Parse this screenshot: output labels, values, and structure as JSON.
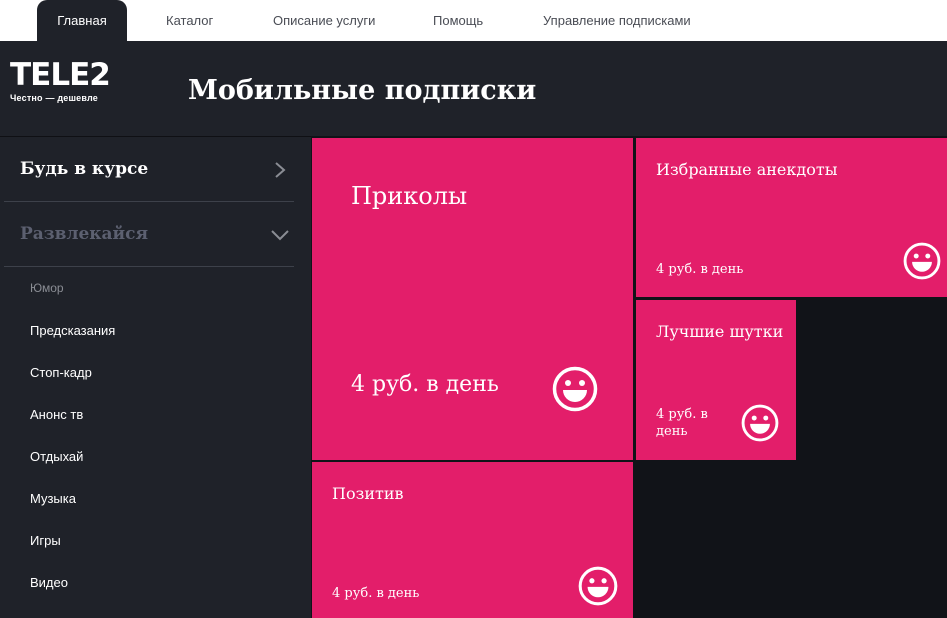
{
  "nav": {
    "tabs": [
      {
        "label": "Главная",
        "active": true
      },
      {
        "label": "Каталог"
      },
      {
        "label": "Описание услуги"
      },
      {
        "label": "Помощь"
      },
      {
        "label": "Управление подписками"
      }
    ]
  },
  "header": {
    "logo_text": "TELE2",
    "logo_tagline": "Честно — дешевле",
    "title": "Мобильные подписки"
  },
  "sidebar": {
    "sections": [
      {
        "label": "Будь в курсе",
        "state": "collapsed"
      },
      {
        "label": "Развлекайся",
        "state": "expanded"
      }
    ],
    "items": [
      "Юмор",
      "Предсказания",
      "Стоп-кадр",
      "Анонс тв",
      "Отдыхай",
      "Музыка",
      "Игры",
      "Видео"
    ]
  },
  "tiles": [
    {
      "title": "Приколы",
      "price": "4 руб. в день",
      "icon": "smile-icon"
    },
    {
      "title": "Избранные анекдоты",
      "price": "4 руб. в день",
      "icon": "smile-icon"
    },
    {
      "title": "Лучшие шутки",
      "price": "4 руб. в день",
      "icon": "smile-icon"
    },
    {
      "title": "Позитив",
      "price": "4 руб. в день",
      "icon": "smile-icon"
    }
  ],
  "colors": {
    "accent": "#e31e6a",
    "dark": "#1f2229",
    "background": "#111318"
  }
}
